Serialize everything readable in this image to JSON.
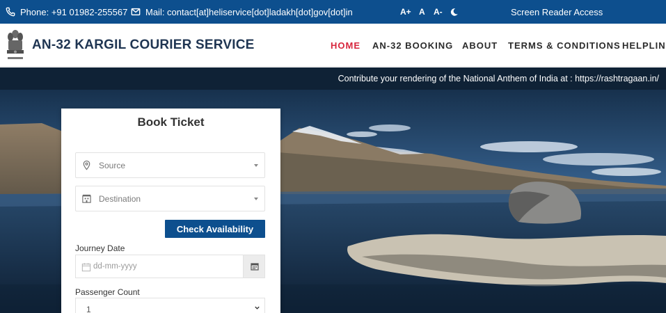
{
  "topbar": {
    "phone_icon": "phone-icon",
    "phone": "Phone: +91 01982-255567",
    "mail_icon": "mail-icon",
    "mail": "Mail: contact[at]heliservice[dot]ladakh[dot]gov[dot]in",
    "font_increase": "A+",
    "font_normal": "A",
    "font_decrease": "A-",
    "theme_icon": "moon-icon",
    "screen_reader": "Screen Reader Access"
  },
  "header": {
    "emblem": "national-emblem",
    "title": "AN-32 KARGIL COURIER SERVICE",
    "nav": [
      {
        "label": "HOME",
        "active": true
      },
      {
        "label": "AN-32 BOOKING",
        "active": false
      },
      {
        "label": "ABOUT",
        "active": false
      },
      {
        "label": "TERMS & CONDITIONS",
        "active": false
      },
      {
        "label": "HELPLINE",
        "active": false
      }
    ]
  },
  "marquee": {
    "text": "Contribute your rendering of the National Anthem of India at : https://rashtragaan.in/"
  },
  "booking": {
    "title": "Book Ticket",
    "source_placeholder": "Source",
    "destination_placeholder": "Destination",
    "check_button": "Check Availability",
    "journey_date_label": "Journey Date",
    "date_placeholder": "dd-mm-yyyy",
    "passenger_count_label": "Passenger Count",
    "passenger_count_value": "1"
  },
  "colors": {
    "topbar": "#0d4f8e",
    "accent_active": "#d7263d",
    "button": "#0d4f8e",
    "marquee": "#0f2236"
  }
}
